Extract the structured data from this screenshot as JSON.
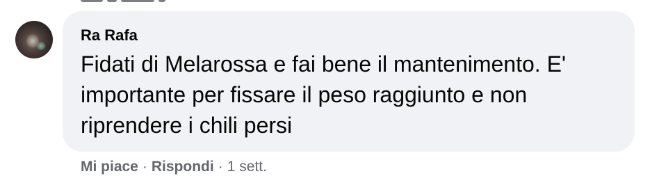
{
  "comment": {
    "author": "Ra Rafa",
    "text": "Fidati di Melarossa e fai bene il mantenimento. E' importante per fissare il peso raggiunto e non riprendere i chili persi",
    "avatar_icon": "user-avatar-photo"
  },
  "actions": {
    "like": "Mi piace",
    "separator": "·",
    "reply": "Rispondi",
    "timestamp": "1 sett."
  },
  "colors": {
    "bubble_bg": "#f0f2f5",
    "text": "#050505",
    "secondary_text": "#65676b"
  }
}
